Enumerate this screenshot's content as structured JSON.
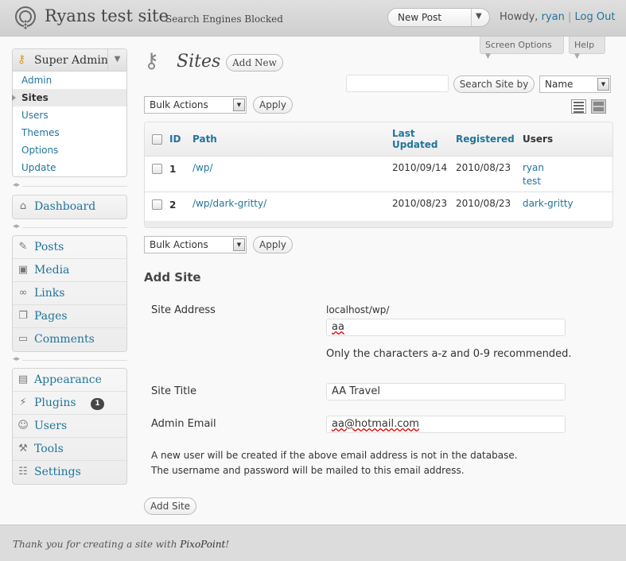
{
  "header": {
    "site_title": "Ryans test site",
    "site_flag": "Search Engines Blocked",
    "new_post_label": "New Post",
    "howdy_prefix": "Howdy,",
    "username": "ryan",
    "logout_label": "Log Out"
  },
  "screen_tabs": {
    "screen_options": "Screen Options",
    "help": "Help"
  },
  "sidebar": {
    "super_admin": {
      "title": "Super Admin",
      "items": [
        "Admin",
        "Sites",
        "Users",
        "Themes",
        "Options",
        "Update"
      ],
      "current": "Sites"
    },
    "dashboard": "Dashboard",
    "group1": [
      "Posts",
      "Media",
      "Links",
      "Pages",
      "Comments"
    ],
    "group2": [
      "Appearance",
      "Plugins",
      "Users",
      "Tools",
      "Settings"
    ],
    "plugins_badge": "1"
  },
  "main": {
    "title": "Sites",
    "add_new_label": "Add New",
    "search": {
      "input_value": "",
      "button_label": "Search Site by",
      "field_selected": "Name"
    },
    "bulk_actions_label": "Bulk Actions",
    "apply_label": "Apply",
    "table": {
      "headers": {
        "id": "ID",
        "path": "Path",
        "last_updated_line1": "Last",
        "last_updated_line2": "Updated",
        "registered": "Registered",
        "users": "Users"
      },
      "rows": [
        {
          "id": "1",
          "path": "/wp/",
          "last_updated": "2010/09/14",
          "registered": "2010/08/23",
          "users": [
            "ryan",
            "test"
          ]
        },
        {
          "id": "2",
          "path": "/wp/dark-gritty/",
          "last_updated": "2010/08/23",
          "registered": "2010/08/23",
          "users": [
            "dark-gritty"
          ]
        }
      ]
    },
    "add_site": {
      "heading": "Add Site",
      "address_label": "Site Address",
      "address_prefix": "localhost/wp/",
      "address_value": "aa",
      "address_hint": "Only the characters a-z and 0-9 recommended.",
      "title_label": "Site Title",
      "title_value": "AA Travel",
      "email_label": "Admin Email",
      "email_value": "aa@hotmail.com",
      "note_line1": "A new user will be created if the above email address is not in the database.",
      "note_line2": "The username and password will be mailed to this email address.",
      "submit_label": "Add Site"
    }
  },
  "footer": {
    "text_prefix": "Thank you for creating a site with",
    "brand": "PixoPoint",
    "text_suffix": "!"
  },
  "colors": {
    "link": "#21759b",
    "header_bg": "#d7d7d7",
    "badge_bg": "#464646"
  },
  "icons": {
    "logo": "wordpress-logo",
    "super_admin": "keys-icon",
    "page": "keys-icon"
  }
}
